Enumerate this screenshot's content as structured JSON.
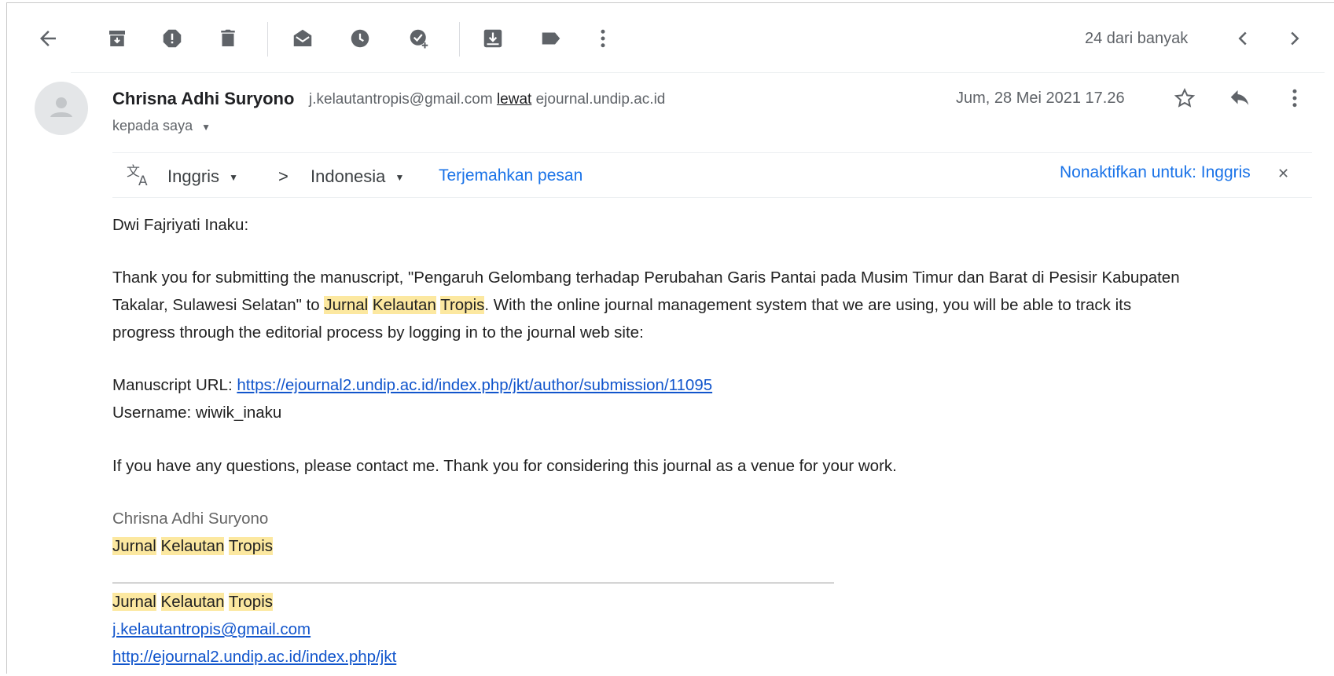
{
  "toolbar": {
    "count_label": "24 dari banyak",
    "icons": [
      "back-arrow-icon",
      "archive-icon",
      "report-spam-icon",
      "delete-icon",
      "mark-unread-icon",
      "snooze-icon",
      "add-task-icon",
      "move-to-icon",
      "label-icon",
      "more-vert-icon",
      "prev-chevron-icon",
      "next-chevron-icon"
    ]
  },
  "message": {
    "sender_name": "Chrisna Adhi Suryono",
    "sender_email": "j.kelautantropis@gmail.com",
    "via_label": "lewat",
    "via_domain": "ejournal.undip.ac.id",
    "recipient": "kepada saya",
    "date": "Jum, 28 Mei 2021 17.26"
  },
  "translate": {
    "from_lang": "Inggris",
    "arrow": ">",
    "to_lang": "Indonesia",
    "translate_link": "Terjemahkan pesan",
    "disable_link": "Nonaktifkan untuk: Inggris"
  },
  "body": {
    "greeting": "Dwi Fajriyati Inaku:",
    "p1_l1": "Thank you for submitting the manuscript, \"Pengaruh Gelombang terhadap Perubahan Garis Pantai pada Musim Timur dan Barat di Pesisir Kabupaten",
    "p1_l2_a": "Takalar, Sulawesi Selatan\" to ",
    "journal_w1": "Jurnal",
    "journal_w2": "Kelautan",
    "journal_w3": "Tropis",
    "p1_l2_b": ". With the online journal management system that we are using, you will be able to track its",
    "p1_l3": "progress through the editorial process by logging in to the journal web site:",
    "url_label": "Manuscript URL: ",
    "url": "https://ejournal2.undip.ac.id/index.php/jkt/author/submission/11095",
    "username_line": "Username: wiwik_inaku",
    "p2": "If you have any questions, please contact me. Thank you for considering this journal as a venue for your work.",
    "sig_name": "Chrisna Adhi Suryono",
    "sig_email": "j.kelautantropis@gmail.com",
    "sig_url": "http://ejournal2.undip.ac.id/index.php/jkt"
  }
}
